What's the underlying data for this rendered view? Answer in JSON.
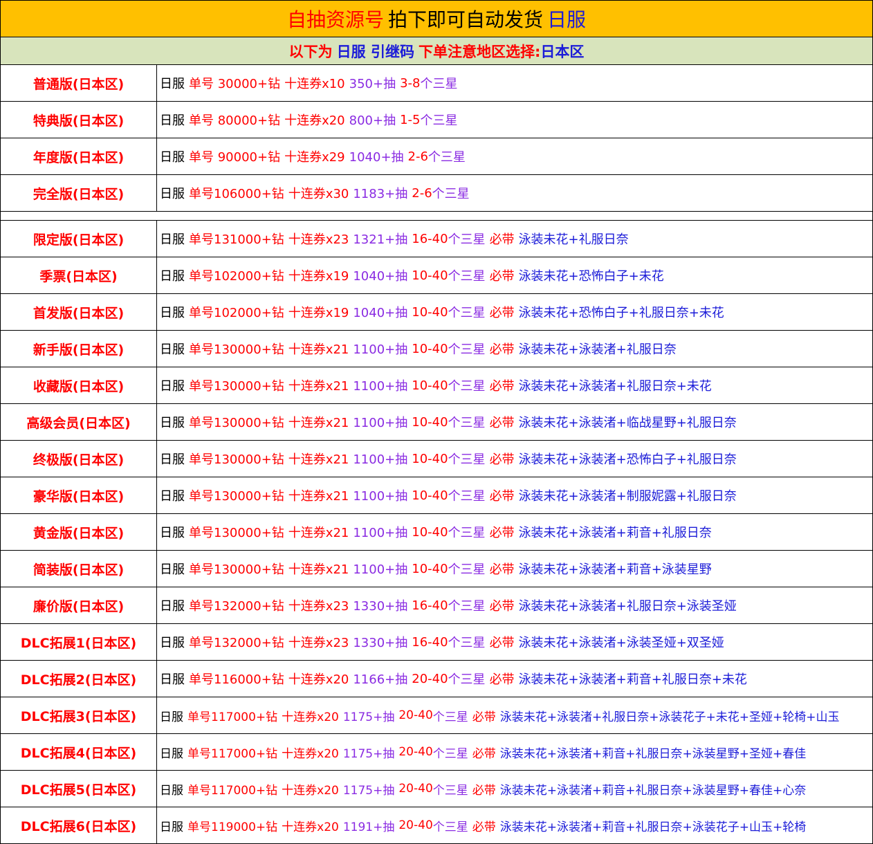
{
  "header": {
    "title_part1": "自抽资源号",
    "title_part2": "拍下即可自动发货",
    "title_part3": "日服",
    "colors": {
      "red": "#ff0000",
      "black": "#000000",
      "blue": "#1c1cd8"
    }
  },
  "notice": {
    "part1": "以下为",
    "part2": "日服 引继码",
    "part3": "下单注意地区选择:",
    "part4": "日本区"
  },
  "top_rows": [
    {
      "label": "普通版(日本区)",
      "server": "日服",
      "account": "单号  30000+钻",
      "tickets": "十连券x10",
      "pulls": "350+抽",
      "stars_num": "3-8",
      "stars_text": "个三星",
      "bonus_prefix": "",
      "bonus": ""
    },
    {
      "label": "特典版(日本区)",
      "server": "日服",
      "account": "单号  80000+钻",
      "tickets": "十连券x20",
      "pulls": "800+抽",
      "stars_num": "1-5",
      "stars_text": "个三星",
      "bonus_prefix": "",
      "bonus": ""
    },
    {
      "label": "年度版(日本区)",
      "server": "日服",
      "account": "单号  90000+钻",
      "tickets": "十连券x29",
      "pulls": "1040+抽",
      "stars_num": "2-6",
      "stars_text": "个三星",
      "bonus_prefix": "",
      "bonus": ""
    },
    {
      "label": "完全版(日本区)",
      "server": "日服",
      "account": "单号106000+钻",
      "tickets": "十连券x30",
      "pulls": "1183+抽",
      "stars_num": "2-6",
      "stars_text": "个三星",
      "bonus_prefix": "",
      "bonus": ""
    }
  ],
  "bottom_rows": [
    {
      "label": "限定版(日本区)",
      "server": "日服",
      "account": "单号131000+钻",
      "tickets": "十连券x23",
      "pulls": "1321+抽",
      "stars_num": "16-40",
      "stars_text": "个三星",
      "bonus_prefix": "必带",
      "bonus": "泳装未花+礼服日奈"
    },
    {
      "label": "季票(日本区)",
      "server": "日服",
      "account": "单号102000+钻",
      "tickets": "十连券x19",
      "pulls": "1040+抽",
      "stars_num": "10-40",
      "stars_text": "个三星",
      "bonus_prefix": "必带",
      "bonus": "泳装未花+恐怖白子+未花"
    },
    {
      "label": "首发版(日本区)",
      "server": "日服",
      "account": "单号102000+钻",
      "tickets": "十连券x19",
      "pulls": "1040+抽",
      "stars_num": "10-40",
      "stars_text": "个三星",
      "bonus_prefix": "必带",
      "bonus": "泳装未花+恐怖白子+礼服日奈+未花"
    },
    {
      "label": "新手版(日本区)",
      "server": "日服",
      "account": "单号130000+钻",
      "tickets": "十连券x21",
      "pulls": "1100+抽",
      "stars_num": "10-40",
      "stars_text": "个三星",
      "bonus_prefix": "必带",
      "bonus": "泳装未花+泳装渚+礼服日奈"
    },
    {
      "label": "收藏版(日本区)",
      "server": "日服",
      "account": "单号130000+钻",
      "tickets": "十连券x21",
      "pulls": "1100+抽",
      "stars_num": "10-40",
      "stars_text": "个三星",
      "bonus_prefix": "必带",
      "bonus": "泳装未花+泳装渚+礼服日奈+未花"
    },
    {
      "label": "高级会员(日本区)",
      "server": "日服",
      "account": "单号130000+钻",
      "tickets": "十连券x21",
      "pulls": "1100+抽",
      "stars_num": "10-40",
      "stars_text": "个三星",
      "bonus_prefix": "必带",
      "bonus": "泳装未花+泳装渚+临战星野+礼服日奈"
    },
    {
      "label": "终极版(日本区)",
      "server": "日服",
      "account": "单号130000+钻",
      "tickets": "十连券x21",
      "pulls": "1100+抽",
      "stars_num": "10-40",
      "stars_text": "个三星",
      "bonus_prefix": "必带",
      "bonus": "泳装未花+泳装渚+恐怖白子+礼服日奈"
    },
    {
      "label": "豪华版(日本区)",
      "server": "日服",
      "account": "单号130000+钻",
      "tickets": "十连券x21",
      "pulls": "1100+抽",
      "stars_num": "10-40",
      "stars_text": "个三星",
      "bonus_prefix": "必带",
      "bonus": "泳装未花+泳装渚+制服妮露+礼服日奈"
    },
    {
      "label": "黄金版(日本区)",
      "server": "日服",
      "account": "单号130000+钻",
      "tickets": "十连券x21",
      "pulls": "1100+抽",
      "stars_num": "10-40",
      "stars_text": "个三星",
      "bonus_prefix": "必带",
      "bonus": "泳装未花+泳装渚+莉音+礼服日奈"
    },
    {
      "label": "简装版(日本区)",
      "server": "日服",
      "account": "单号130000+钻",
      "tickets": "十连券x21",
      "pulls": "1100+抽",
      "stars_num": "10-40",
      "stars_text": "个三星",
      "bonus_prefix": "必带",
      "bonus": "泳装未花+泳装渚+莉音+泳装星野"
    },
    {
      "label": "廉价版(日本区)",
      "server": "日服",
      "account": "单号132000+钻",
      "tickets": "十连券x23",
      "pulls": "1330+抽",
      "stars_num": "16-40",
      "stars_text": "个三星",
      "bonus_prefix": "必带",
      "bonus": "泳装未花+泳装渚+礼服日奈+泳装圣娅"
    },
    {
      "label": "DLC拓展1(日本区)",
      "server": "日服",
      "account": "单号132000+钻",
      "tickets": "十连券x23",
      "pulls": "1330+抽",
      "stars_num": "16-40",
      "stars_text": "个三星",
      "bonus_prefix": "必带",
      "bonus": "泳装未花+泳装渚+泳装圣娅+双圣娅"
    },
    {
      "label": "DLC拓展2(日本区)",
      "server": "日服",
      "account": "单号116000+钻",
      "tickets": "十连券x20",
      "pulls": "1166+抽",
      "stars_num": "20-40",
      "stars_text": "个三星",
      "bonus_prefix": "必带",
      "bonus": "泳装未花+泳装渚+莉音+礼服日奈+未花"
    },
    {
      "label": "DLC拓展3(日本区)",
      "server": "日服",
      "account": "单号117000+钻",
      "tickets": "十连券x20",
      "pulls": "1175+抽",
      "stars_num": "20-40",
      "stars_text": "个三星",
      "bonus_prefix": "必带",
      "bonus": "泳装未花+泳装渚+礼服日奈+泳装花子+未花+圣娅+轮椅+山玉",
      "small": true
    },
    {
      "label": "DLC拓展4(日本区)",
      "server": "日服",
      "account": "单号117000+钻",
      "tickets": "十连券x20",
      "pulls": "1175+抽",
      "stars_num": "20-40",
      "stars_text": "个三星",
      "bonus_prefix": "必带",
      "bonus": "泳装未花+泳装渚+莉音+礼服日奈+泳装星野+圣娅+春佳",
      "small": true
    },
    {
      "label": "DLC拓展5(日本区)",
      "server": "日服",
      "account": "单号117000+钻",
      "tickets": "十连券x20",
      "pulls": "1175+抽",
      "stars_num": "20-40",
      "stars_text": "个三星",
      "bonus_prefix": "必带",
      "bonus": "泳装未花+泳装渚+莉音+礼服日奈+泳装星野+春佳+心奈",
      "small": true
    },
    {
      "label": "DLC拓展6(日本区)",
      "server": "日服",
      "account": "单号119000+钻",
      "tickets": "十连券x20",
      "pulls": "1191+抽",
      "stars_num": "20-40",
      "stars_text": "个三星",
      "bonus_prefix": "必带",
      "bonus": "泳装未花+泳装渚+莉音+礼服日奈+泳装花子+山玉+轮椅",
      "small": true
    }
  ]
}
